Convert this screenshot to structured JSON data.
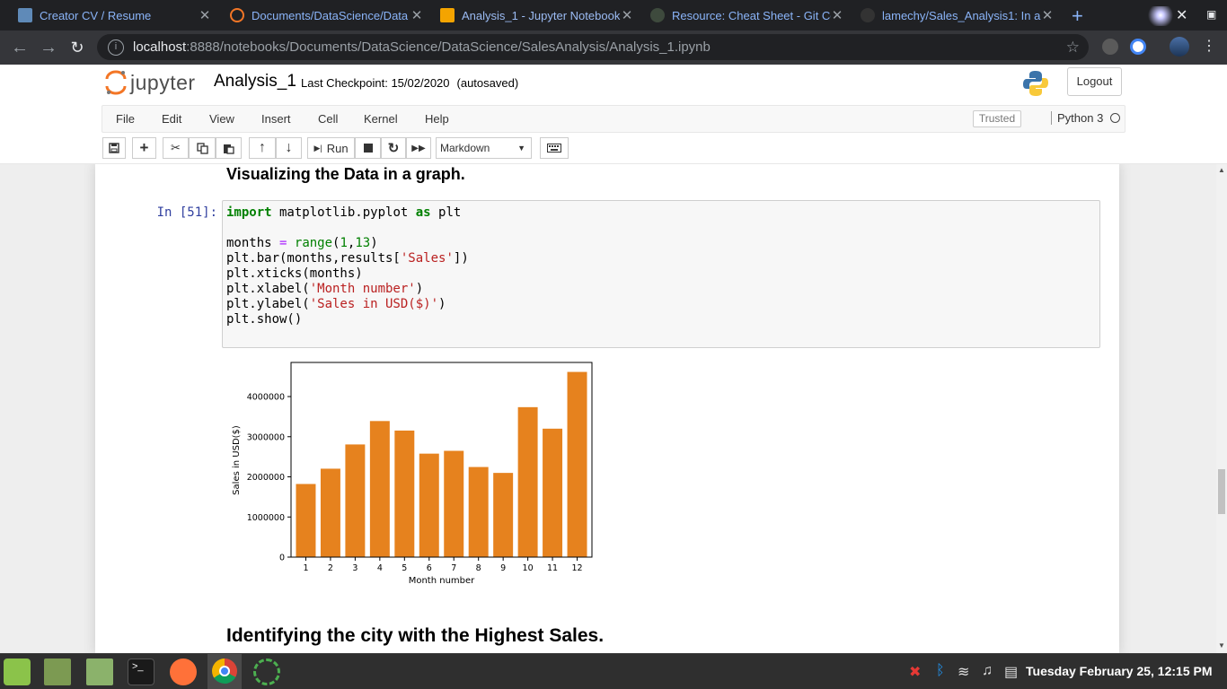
{
  "browser": {
    "tabs": [
      {
        "title": "Creator CV / Resume",
        "favicon": "document-icon"
      },
      {
        "title": "Documents/DataScience/Data",
        "favicon": "jupyter-icon"
      },
      {
        "title": "Analysis_1 - Jupyter Notebook",
        "favicon": "notebook-icon"
      },
      {
        "title": "Resource: Cheat Sheet - Git Co",
        "favicon": "tree-icon"
      },
      {
        "title": "lamechy/Sales_Analysis1: In a",
        "favicon": "github-icon"
      }
    ],
    "active_tab": 2,
    "url_host": "localhost",
    "url_path": ":8888/notebooks/Documents/DataScience/DataScience/SalesAnalysis/Analysis_1.ipynb"
  },
  "jupyter": {
    "logo_text": "jupyter",
    "notebook_name": "Analysis_1",
    "checkpoint": "Last Checkpoint: 15/02/2020",
    "autosave": "(autosaved)",
    "logout_label": "Logout",
    "menu": [
      "File",
      "Edit",
      "View",
      "Insert",
      "Cell",
      "Kernel",
      "Help"
    ],
    "trusted_label": "Trusted",
    "kernel_name": "Python 3",
    "run_label": "Run",
    "cell_type": "Markdown"
  },
  "notebook": {
    "heading1": "Visualizing the Data in a graph.",
    "prompt": "In [51]:",
    "heading2": "Identifying the city with the Highest Sales."
  },
  "chart_data": {
    "type": "bar",
    "categories": [
      "1",
      "2",
      "3",
      "4",
      "5",
      "6",
      "7",
      "8",
      "9",
      "10",
      "11",
      "12"
    ],
    "values": [
      1822000,
      2203000,
      2807000,
      3390000,
      3153000,
      2578000,
      2648000,
      2245000,
      2098000,
      3736000,
      3200000,
      4614000
    ],
    "xlabel": "Month number",
    "ylabel": "Sales in USD($)",
    "yticks": [
      0,
      1000000,
      2000000,
      3000000,
      4000000
    ],
    "ylim": [
      0,
      4850000
    ],
    "color": "#e6821e",
    "grid": false
  },
  "taskbar": {
    "clock": "Tuesday February 25, 12:15 PM"
  },
  "colors": {
    "jupyter_orange": "#f37626",
    "prompt_blue": "#303f9f",
    "bar": "#e6821e"
  }
}
